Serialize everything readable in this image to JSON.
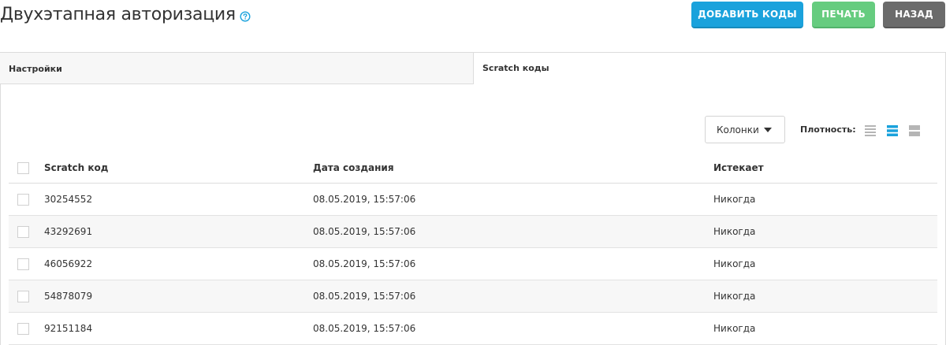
{
  "header": {
    "title": "Двухэтапная авторизация",
    "help_icon": "question-circle-icon",
    "buttons": {
      "add_codes": "ДОБАВИТЬ КОДЫ",
      "print": "ПЕЧАТЬ",
      "back": "НАЗАД"
    }
  },
  "tabs": [
    {
      "label": "Настройки",
      "active": false
    },
    {
      "label": "Scratch коды",
      "active": true
    }
  ],
  "toolbar": {
    "columns_label": "Колонки",
    "density_label": "Плотность:",
    "density_options": [
      "compact-icon",
      "normal-icon",
      "comfortable-icon"
    ],
    "density_selected": "normal-icon"
  },
  "table": {
    "headers": [
      "Scratch код",
      "Дата создания",
      "Истекает"
    ],
    "rows": [
      [
        "30254552",
        "08.05.2019, 15:57:06",
        "Никогда"
      ],
      [
        "43292691",
        "08.05.2019, 15:57:06",
        "Никогда"
      ],
      [
        "46056922",
        "08.05.2019, 15:57:06",
        "Никогда"
      ],
      [
        "54878079",
        "08.05.2019, 15:57:06",
        "Никогда"
      ],
      [
        "92151184",
        "08.05.2019, 15:57:06",
        "Никогда"
      ]
    ]
  },
  "colors": {
    "primary": "#1aa2dc",
    "success": "#66cc7f",
    "secondary": "#6b6b6b"
  }
}
